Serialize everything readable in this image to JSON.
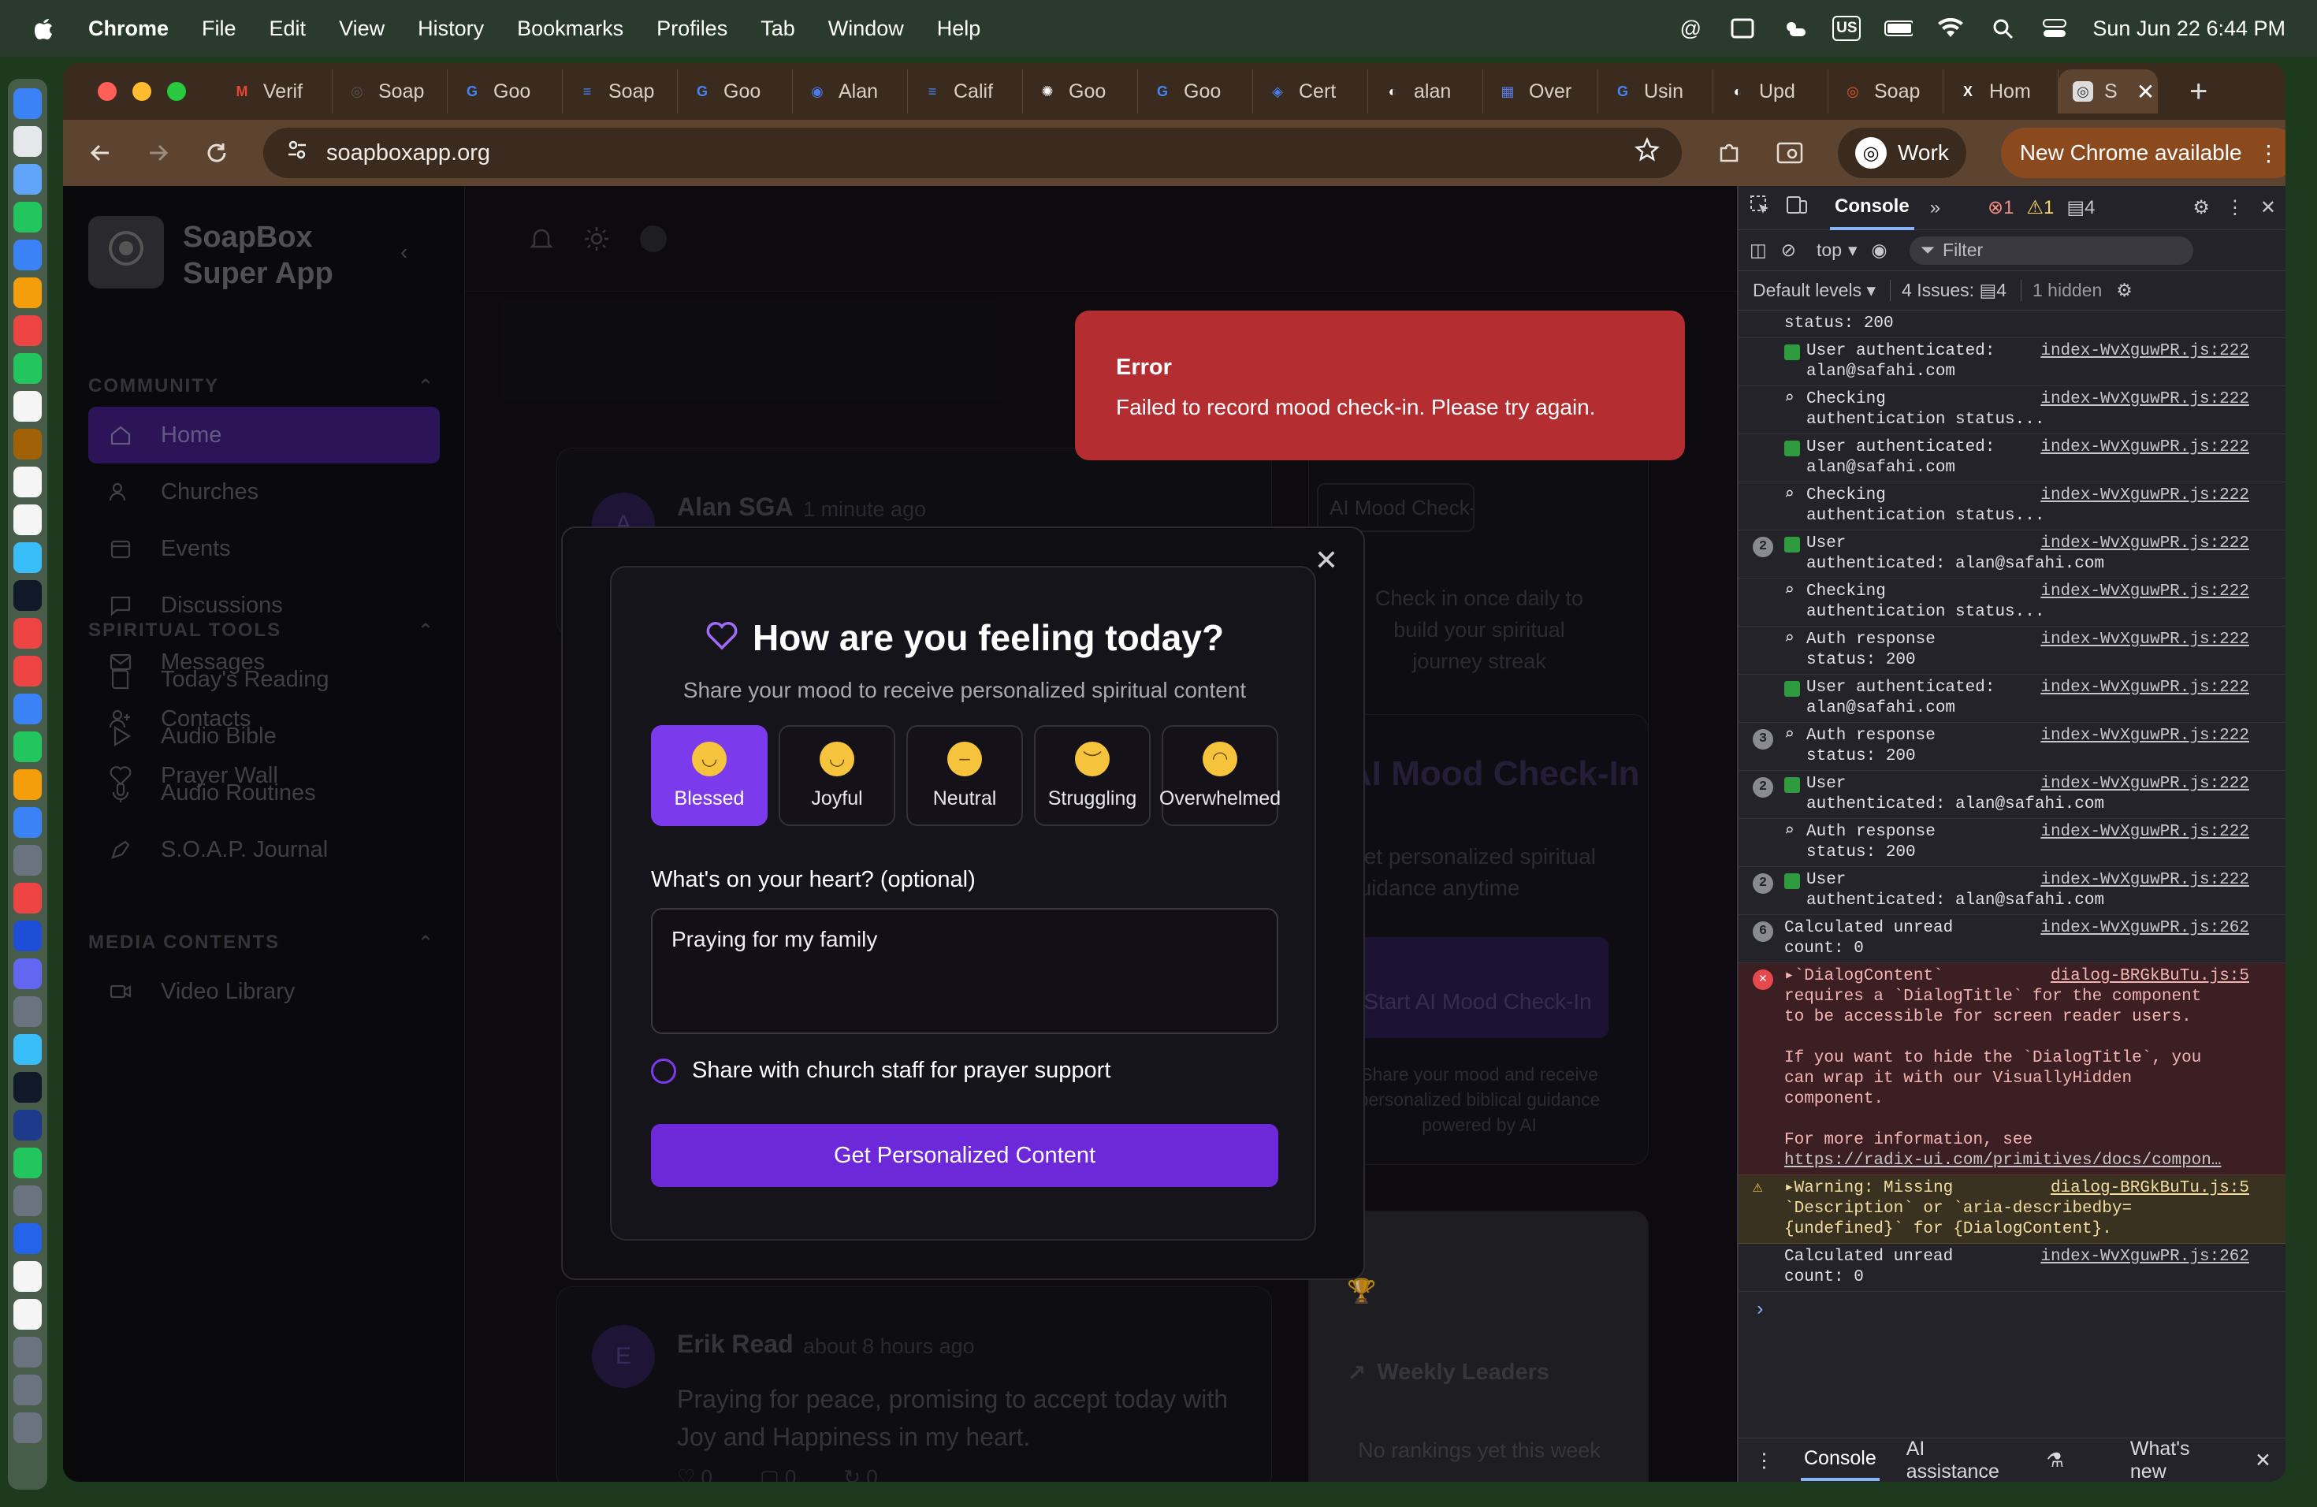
{
  "menubar": {
    "app_name": "Chrome",
    "items": [
      "File",
      "Edit",
      "View",
      "History",
      "Bookmarks",
      "Profiles",
      "Tab",
      "Window",
      "Help"
    ],
    "keyboard_layout": "US",
    "datetime": "Sun Jun 22  6:44 PM"
  },
  "tabs": [
    {
      "title": "Verif",
      "icon": "gmail-icon",
      "color": "#ea4335"
    },
    {
      "title": "Soap",
      "icon": "soapbox-icon",
      "color": "#555555"
    },
    {
      "title": "Goo",
      "icon": "google-icon",
      "color": "#4285f4"
    },
    {
      "title": "Soap",
      "icon": "docs-icon",
      "color": "#4285f4"
    },
    {
      "title": "Goo",
      "icon": "google-icon",
      "color": "#4285f4"
    },
    {
      "title": "Alan",
      "icon": "cloud-icon",
      "color": "#4a7cf0"
    },
    {
      "title": "Calif",
      "icon": "docs-icon",
      "color": "#4285f4"
    },
    {
      "title": "Goo",
      "icon": "openai-icon",
      "color": "#ffffff"
    },
    {
      "title": "Goo",
      "icon": "google-icon",
      "color": "#4285f4"
    },
    {
      "title": "Cert",
      "icon": "shield-icon",
      "color": "#4a7cf0"
    },
    {
      "title": "alan",
      "icon": "github-icon",
      "color": "#ffffff"
    },
    {
      "title": "Over",
      "icon": "building-icon",
      "color": "#5a7be0"
    },
    {
      "title": "Usin",
      "icon": "google-icon",
      "color": "#4285f4"
    },
    {
      "title": "Upd",
      "icon": "github-icon",
      "color": "#ffffff"
    },
    {
      "title": "Soap",
      "icon": "soapbox-icon",
      "color": "#e05a2a"
    },
    {
      "title": "Hom",
      "icon": "x-icon",
      "color": "#ffffff"
    }
  ],
  "active_tab": {
    "title": "S",
    "icon": "soapbox-icon"
  },
  "toolbar": {
    "url": "soapboxapp.org",
    "profile_label": "Work",
    "update_label": "New Chrome available"
  },
  "app": {
    "brand": "SoapBox Super App",
    "logo_text": "SOAPBOX",
    "sections": [
      {
        "heading": "COMMUNITY",
        "items": [
          {
            "label": "Home",
            "icon": "home-icon",
            "active": true
          },
          {
            "label": "Churches",
            "icon": "users-icon"
          },
          {
            "label": "Events",
            "icon": "calendar-icon"
          },
          {
            "label": "Discussions",
            "icon": "chat-icon"
          },
          {
            "label": "Messages",
            "icon": "mail-icon"
          },
          {
            "label": "Contacts",
            "icon": "user-plus-icon"
          },
          {
            "label": "Prayer Wall",
            "icon": "heart-icon"
          }
        ]
      },
      {
        "heading": "SPIRITUAL TOOLS",
        "items": [
          {
            "label": "Today's Reading",
            "icon": "book-icon"
          },
          {
            "label": "Audio Bible",
            "icon": "play-icon"
          },
          {
            "label": "Audio Routines",
            "icon": "mic-icon"
          },
          {
            "label": "S.O.A.P. Journal",
            "icon": "pen-icon"
          }
        ]
      },
      {
        "heading": "MEDIA CONTENTS",
        "items": [
          {
            "label": "Video Library",
            "icon": "video-icon"
          }
        ]
      }
    ],
    "posts": [
      {
        "initial": "A",
        "author": "Alan SGA",
        "time": "1 minute ago"
      },
      {
        "initial": "E",
        "author": "Erik Read",
        "time": "about 8 hours ago",
        "text": "Praying for peace, promising to accept today with Joy and Happiness in my heart.",
        "likes": "0",
        "comments": "0",
        "shares": "0"
      }
    ],
    "right_cards": {
      "checkin_badge": "AI Mood Check-in",
      "checkin_text": "Check in once daily to build your spiritual journey streak",
      "mood_title": "AI Mood Check-In",
      "mood_sub": "Get personalized spiritual guidance anytime",
      "mood_button": "Start AI Mood Check-In",
      "mood_footer": "Share your mood and receive personalized biblical guidance powered by AI",
      "leaders_title": "Weekly Leaders",
      "leaders_empty": "No rankings yet this week"
    }
  },
  "dialog": {
    "title": "How are you feeling today?",
    "subtitle": "Share your mood to receive personalized spiritual content",
    "moods": [
      {
        "label": "Blessed",
        "selected": true
      },
      {
        "label": "Joyful"
      },
      {
        "label": "Neutral"
      },
      {
        "label": "Struggling"
      },
      {
        "label": "Overwhelmed"
      }
    ],
    "heart_label": "What's on your heart? (optional)",
    "heart_value": "Praying for my family",
    "share_label": "Share with church staff for prayer support",
    "submit_label": "Get Personalized Content"
  },
  "toast": {
    "title": "Error",
    "message": "Failed to record mood check-in. Please try again."
  },
  "devtools": {
    "panel": "Console",
    "errors": "1",
    "warnings": "1",
    "messages": "4",
    "context": "top",
    "filter_placeholder": "Filter",
    "levels": "Default levels",
    "issues": "4 Issues:",
    "issues_count": "4",
    "hidden": "1 hidden",
    "logs": [
      {
        "msg": "status: 200",
        "src": "",
        "kind": "plain"
      },
      {
        "msg": "User authenticated:\nalan@safahi.com",
        "src": "index-WvXguwPR.js:222",
        "kind": "ok"
      },
      {
        "msg": "Checking\nauthentication status...",
        "src": "index-WvXguwPR.js:222",
        "kind": "search"
      },
      {
        "msg": "User authenticated:\nalan@safahi.com",
        "src": "index-WvXguwPR.js:222",
        "kind": "ok"
      },
      {
        "msg": "Checking\nauthentication status...",
        "src": "index-WvXguwPR.js:222",
        "kind": "search"
      },
      {
        "msg": "User\nauthenticated: alan@safahi.com",
        "src": "index-WvXguwPR.js:222",
        "kind": "ok",
        "count": "2"
      },
      {
        "msg": "Checking\nauthentication status...",
        "src": "index-WvXguwPR.js:222",
        "kind": "search"
      },
      {
        "msg": "Auth response\nstatus: 200",
        "src": "index-WvXguwPR.js:222",
        "kind": "search"
      },
      {
        "msg": "User authenticated:\nalan@safahi.com",
        "src": "index-WvXguwPR.js:222",
        "kind": "ok"
      },
      {
        "msg": "Auth response\nstatus: 200",
        "src": "index-WvXguwPR.js:222",
        "kind": "search",
        "count": "3"
      },
      {
        "msg": "User\nauthenticated: alan@safahi.com",
        "src": "index-WvXguwPR.js:222",
        "kind": "ok",
        "count": "2"
      },
      {
        "msg": "Auth response\nstatus: 200",
        "src": "index-WvXguwPR.js:222",
        "kind": "search"
      },
      {
        "msg": "User\nauthenticated: alan@safahi.com",
        "src": "index-WvXguwPR.js:222",
        "kind": "ok",
        "count": "2"
      },
      {
        "msg": "Calculated unread\ncount: 0",
        "src": "index-WvXguwPR.js:262",
        "kind": "plain",
        "count": "6"
      }
    ],
    "error_log": {
      "src": "dialog-BRGkBuTu.js:5",
      "msg": "▸`DialogContent`\nrequires a `DialogTitle` for the component\nto be accessible for screen reader users.\n\nIf you want to hide the `DialogTitle`, you\ncan wrap it with our VisuallyHidden\ncomponent.\n\nFor more information, see",
      "link": "https://radix-ui.com/primitives/docs/compon…"
    },
    "warn_log": {
      "src": "dialog-BRGkBuTu.js:5",
      "msg": "▸Warning: Missing\n`Description` or `aria-describedby=\n{undefined}` for {DialogContent}."
    },
    "last_log": {
      "msg": "Calculated unread\ncount: 0",
      "src": "index-WvXguwPR.js:262"
    },
    "drawer_tabs": [
      "Console",
      "AI assistance",
      "What's new"
    ]
  },
  "colors": {
    "accent": "#7c3aed",
    "toast_error": "#b32d31",
    "chrome_frame": "#5c4431"
  }
}
